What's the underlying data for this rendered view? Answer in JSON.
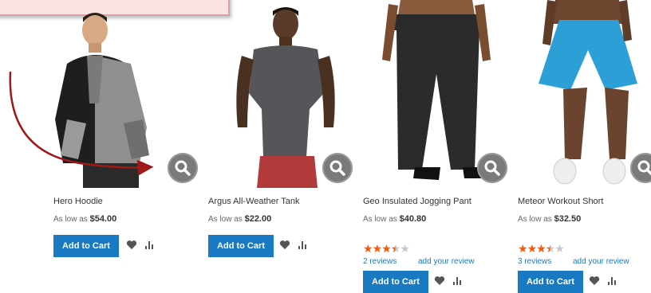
{
  "products": [
    {
      "name": "Hero Hoodie",
      "price_prefix": "As low as",
      "price": "$54.00",
      "add_label": "Add to Cart"
    },
    {
      "name": "Argus All-Weather Tank",
      "price_prefix": "As low as",
      "price": "$22.00",
      "add_label": "Add to Cart"
    },
    {
      "name": "Geo Insulated Jogging Pant",
      "price_prefix": "As low as",
      "price": "$40.80",
      "add_label": "Add to Cart",
      "rating": 3.5,
      "reviews_link": "2  reviews",
      "add_review_link": "add your review"
    },
    {
      "name": "Meteor Workout Short",
      "price_prefix": "As low as",
      "price": "$32.50",
      "add_label": "Add to Cart",
      "rating": 3.5,
      "reviews_link": "3  reviews",
      "add_review_link": "add your review"
    }
  ],
  "colors": {
    "accent": "#1979c3",
    "star": "#ff5501",
    "annotation_arrow": "#a01818",
    "tooltip_bg": "#fbe3e4"
  }
}
